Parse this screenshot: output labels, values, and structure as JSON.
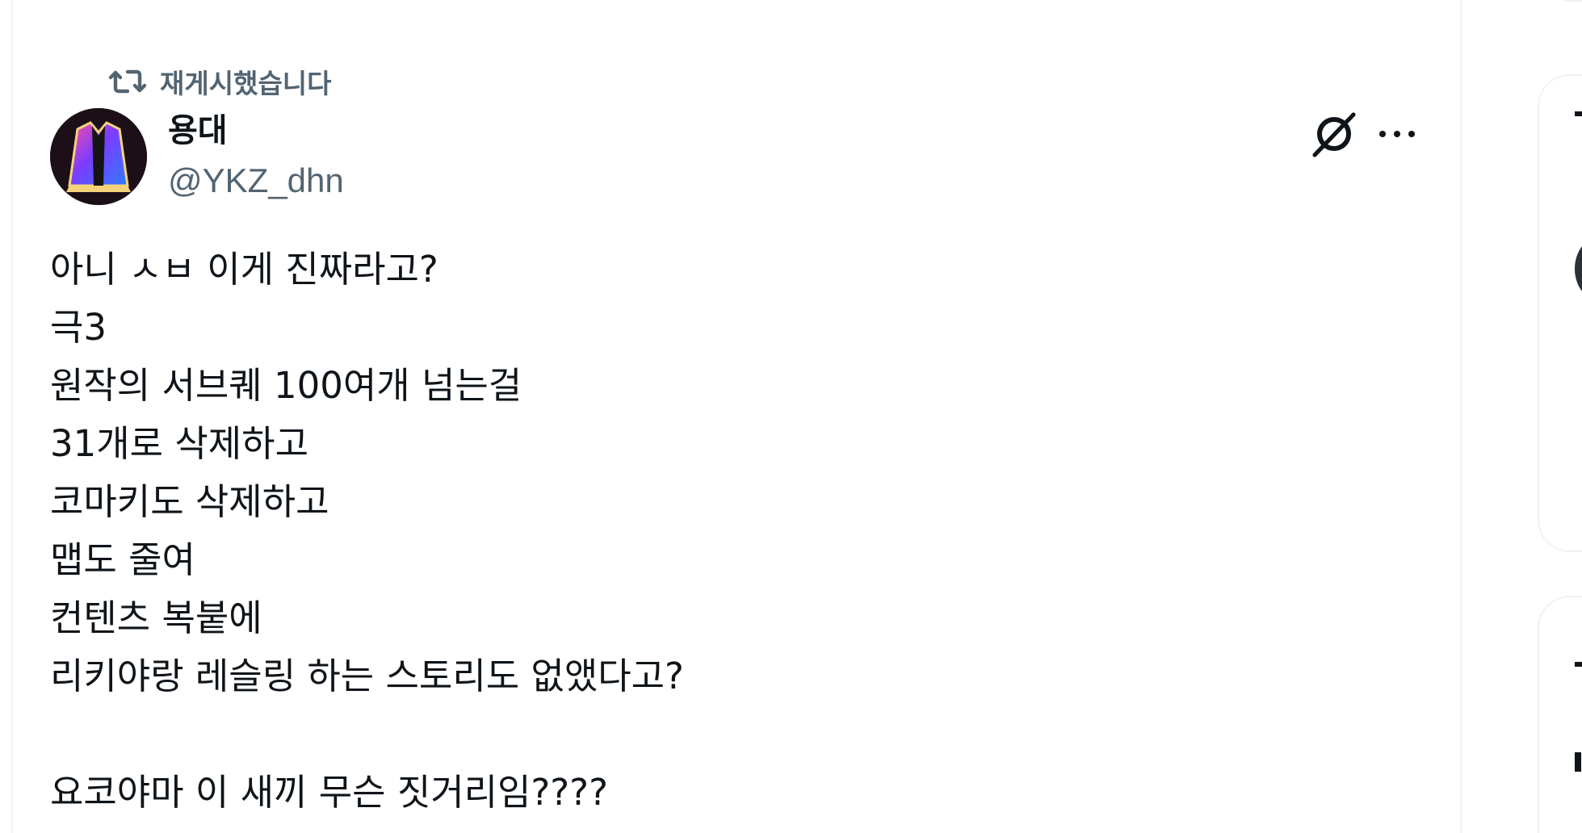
{
  "retweet": {
    "icon": "retweet-icon",
    "label": "재게시했습니다"
  },
  "author": {
    "name": "용대",
    "handle": "@YKZ_dhn",
    "avatar": "avatar-jacket-image"
  },
  "actions": {
    "grok_icon": "grok-icon",
    "more_icon": "more-options-icon"
  },
  "tweet": {
    "lines": [
      "아니 ㅅㅂ 이게 진짜라고?",
      "극3",
      "원작의 서브퀘 100여개 넘는걸",
      "31개로 삭제하고",
      "코마키도 삭제하고",
      "맵도 줄여",
      "컨텐츠 복붙에",
      "리키야랑 레슬링 하는 스토리도 없앴다고?",
      "",
      "요코야마 이 새끼 무슨 짓거리임????"
    ]
  },
  "colors": {
    "text_primary": "#0f1419",
    "text_secondary": "#536471",
    "border": "#eff3f4"
  }
}
